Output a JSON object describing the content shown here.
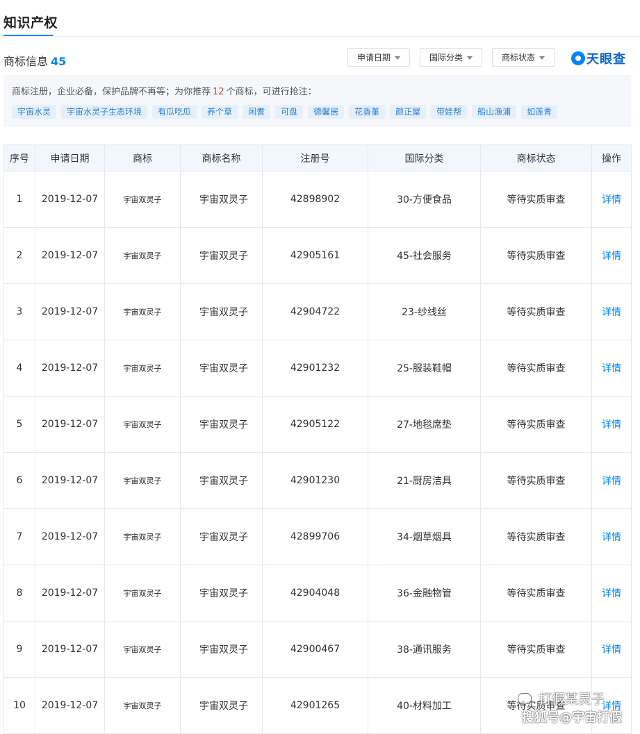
{
  "section": {
    "title": "知识产权"
  },
  "trademark": {
    "label": "商标信息",
    "count": "45"
  },
  "filters": [
    {
      "label": "申请日期"
    },
    {
      "label": "国际分类"
    },
    {
      "label": "商标状态"
    }
  ],
  "logo": {
    "text": "天眼查"
  },
  "recommend": {
    "text_prefix": "商标注册，企业必备，保护品牌不再等；为你推荐",
    "count": "12",
    "text_suffix": "个商标，可进行抢注：",
    "tags": [
      "宇宙水灵",
      "宇宙水灵子生态环境",
      "有瓜吃瓜",
      "养个草",
      "闲耆",
      "可盘",
      "德馨居",
      "花香堇",
      "颜正屋",
      "带娃帮",
      "船山渔浦",
      "如莲青"
    ]
  },
  "table": {
    "headers": [
      "序号",
      "申请日期",
      "商标",
      "商标名称",
      "注册号",
      "国际分类",
      "商标状态",
      "操作"
    ],
    "rows": [
      {
        "no": "1",
        "date": "2019-12-07",
        "logo": "宇宙双灵子",
        "name": "宇宙双灵子",
        "reg": "42898902",
        "class": "30-方便食品",
        "status": "等待实质审查",
        "action": "详情"
      },
      {
        "no": "2",
        "date": "2019-12-07",
        "logo": "宇宙双灵子",
        "name": "宇宙双灵子",
        "reg": "42905161",
        "class": "45-社会服务",
        "status": "等待实质审查",
        "action": "详情"
      },
      {
        "no": "3",
        "date": "2019-12-07",
        "logo": "宇宙双灵子",
        "name": "宇宙双灵子",
        "reg": "42904722",
        "class": "23-纱线丝",
        "status": "等待实质审查",
        "action": "详情"
      },
      {
        "no": "4",
        "date": "2019-12-07",
        "logo": "宇宙双灵子",
        "name": "宇宙双灵子",
        "reg": "42901232",
        "class": "25-服装鞋帽",
        "status": "等待实质审查",
        "action": "详情"
      },
      {
        "no": "5",
        "date": "2019-12-07",
        "logo": "宇宙双灵子",
        "name": "宇宙双灵子",
        "reg": "42905122",
        "class": "27-地毯席垫",
        "status": "等待实质审查",
        "action": "详情"
      },
      {
        "no": "6",
        "date": "2019-12-07",
        "logo": "宇宙双灵子",
        "name": "宇宙双灵子",
        "reg": "42901230",
        "class": "21-厨房洁具",
        "status": "等待实质审查",
        "action": "详情"
      },
      {
        "no": "7",
        "date": "2019-12-07",
        "logo": "宇宙双灵子",
        "name": "宇宙双灵子",
        "reg": "42899706",
        "class": "34-烟草烟具",
        "status": "等待实质审查",
        "action": "详情"
      },
      {
        "no": "8",
        "date": "2019-12-07",
        "logo": "宇宙双灵子",
        "name": "宇宙双灵子",
        "reg": "42904048",
        "class": "36-金融物管",
        "status": "等待实质审查",
        "action": "详情"
      },
      {
        "no": "9",
        "date": "2019-12-07",
        "logo": "宇宙双灵子",
        "name": "宇宙双灵子",
        "reg": "42900467",
        "class": "38-通讯服务",
        "status": "等待实质审查",
        "action": "详情"
      },
      {
        "no": "10",
        "date": "2019-12-07",
        "logo": "宇宙双灵子",
        "name": "宇宙双灵子",
        "reg": "42901265",
        "class": "40-材料加工",
        "status": "等待实质审查",
        "action": "详情"
      }
    ]
  },
  "watermark": {
    "line1": "打假某灵子",
    "line2": "搜狐号@宇宙打假"
  },
  "colors": {
    "accent": "#0084ff",
    "highlight": "#e33b3b",
    "header_bg": "#f2f7fd",
    "tag_bg": "#e6f0fb"
  }
}
